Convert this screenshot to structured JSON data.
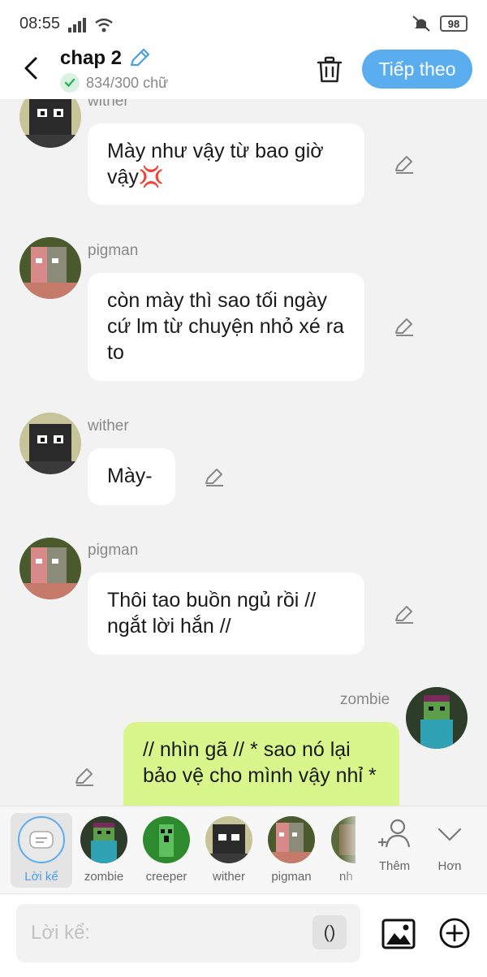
{
  "status_bar": {
    "time": "08:55",
    "battery": "98"
  },
  "header": {
    "title": "chap 2",
    "word_count": "834/300 chữ",
    "next_label": "Tiếp theo"
  },
  "messages": [
    {
      "sender": "wither",
      "text": "Mày như vậy từ bao giờ vậy💢",
      "side": "left"
    },
    {
      "sender": "pigman",
      "text": "còn mày thì sao tối ngày cứ lm từ chuyện nhỏ xé ra to",
      "side": "left"
    },
    {
      "sender": "wither",
      "text": "Mày-",
      "side": "left"
    },
    {
      "sender": "pigman",
      "text": "Thôi tao buồn ngủ rồi // ngắt lời hắn //",
      "side": "left"
    },
    {
      "sender": "zombie",
      "text": "// nhìn gã // * sao nó lại bảo vệ cho mình vậy nhỉ *",
      "side": "right"
    }
  ],
  "characters": [
    {
      "label": "Lời kể",
      "icon": "narrator-icon",
      "selected": true
    },
    {
      "label": "zombie"
    },
    {
      "label": "creeper"
    },
    {
      "label": "wither"
    },
    {
      "label": "pigman"
    },
    {
      "label": "nh"
    }
  ],
  "toolbar": {
    "add_label": "Thêm",
    "more_label": "Hơn"
  },
  "input": {
    "placeholder": "Lời kể:",
    "paren_label": "()"
  },
  "colors": {
    "accent": "#5aaef0",
    "bubble_right": "#d8f68c",
    "background": "#f2f2f2"
  }
}
